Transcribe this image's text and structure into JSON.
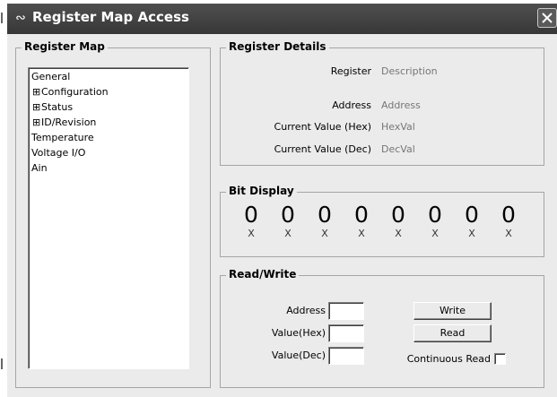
{
  "window": {
    "title": "Register Map Access",
    "icon": "waveform-icon"
  },
  "register_map": {
    "title": "Register Map",
    "items": [
      {
        "label": "General",
        "level": 0
      },
      {
        "label": "Configuration",
        "level": 1,
        "expander": "⊞"
      },
      {
        "label": "Status",
        "level": 1,
        "expander": "⊞"
      },
      {
        "label": "ID/Revision",
        "level": 1,
        "expander": "⊞"
      },
      {
        "label": "Temperature",
        "level": 0
      },
      {
        "label": "Voltage I/O",
        "level": 0
      },
      {
        "label": "Ain",
        "level": 0
      }
    ]
  },
  "register_details": {
    "title": "Register Details",
    "register_label": "Register",
    "register_value": "Description",
    "address_label": "Address",
    "address_value": "Address",
    "hex_label": "Current Value (Hex)",
    "hex_value": "HexVal",
    "dec_label": "Current Value (Dec)",
    "dec_value": "DecVal"
  },
  "bit_display": {
    "title": "Bit Display",
    "bits": [
      {
        "value": "0",
        "mark": "X"
      },
      {
        "value": "0",
        "mark": "X"
      },
      {
        "value": "0",
        "mark": "X"
      },
      {
        "value": "0",
        "mark": "X"
      },
      {
        "value": "0",
        "mark": "X"
      },
      {
        "value": "0",
        "mark": "X"
      },
      {
        "value": "0",
        "mark": "X"
      },
      {
        "value": "0",
        "mark": "X"
      }
    ]
  },
  "read_write": {
    "title": "Read/Write",
    "address_label": "Address",
    "address_value": "",
    "value_hex_label": "Value(Hex)",
    "value_hex_value": "",
    "value_dec_label": "Value(Dec)",
    "value_dec_value": "",
    "write_label": "Write",
    "read_label": "Read",
    "continuous_label": "Continuous Read",
    "continuous_checked": false
  }
}
